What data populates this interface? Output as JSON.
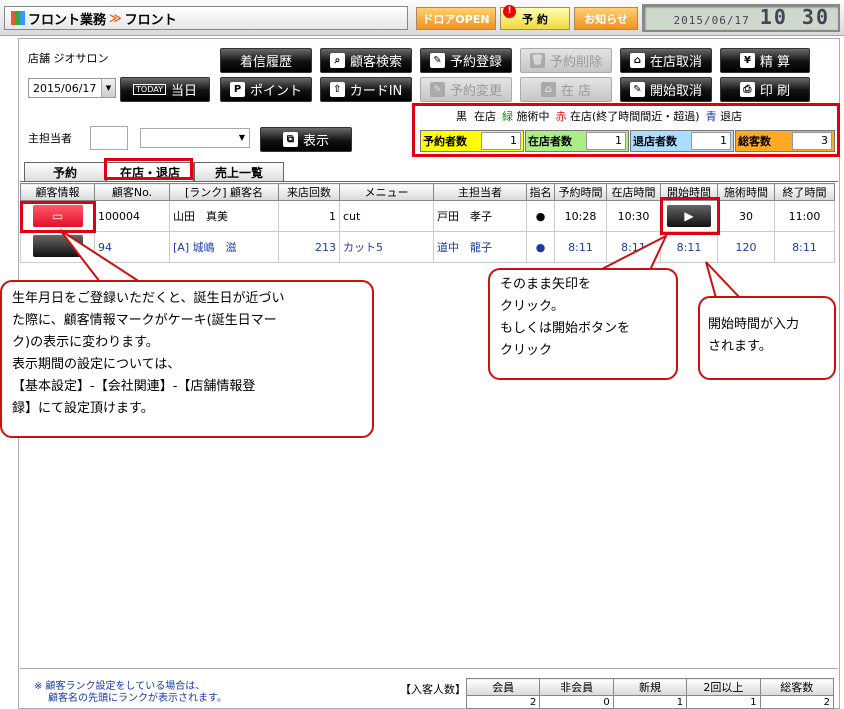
{
  "header": {
    "app_title": "フロント業務",
    "separator": "≫",
    "screen_title": "フロント",
    "buttons": [
      {
        "label": "ドロアOPEN"
      },
      {
        "label": "予 約"
      },
      {
        "label": "お知らせ"
      }
    ],
    "badge": "!",
    "date": "2015/06/17",
    "time": "10 30"
  },
  "store": {
    "label": "店舗",
    "name": "ジオサロン",
    "date": "2015/06/17",
    "today_small": "TODAY",
    "today": "当日"
  },
  "actions": [
    {
      "label": "着信履歴",
      "icon": "",
      "enabled": true
    },
    {
      "label": "顧客検索",
      "icon": "search-icon",
      "enabled": true
    },
    {
      "label": "予約登録",
      "icon": "edit-icon",
      "enabled": true
    },
    {
      "label": "予約削除",
      "icon": "trash-icon",
      "enabled": false
    },
    {
      "label": "在店取消",
      "icon": "home-icon",
      "enabled": true
    },
    {
      "label": "精 算",
      "icon": "yen-icon",
      "enabled": true
    },
    {
      "label": "ポイント",
      "icon": "p-icon",
      "enabled": true
    },
    {
      "label": "カードIN",
      "icon": "up-icon",
      "enabled": true
    },
    {
      "label": "予約変更",
      "icon": "edit-icon",
      "enabled": false
    },
    {
      "label": "在 店",
      "icon": "home-icon",
      "enabled": false
    },
    {
      "label": "開始取消",
      "icon": "edit-icon",
      "enabled": true
    },
    {
      "label": "印 刷",
      "icon": "print-icon",
      "enabled": true
    }
  ],
  "legend": [
    {
      "key": "黒",
      "text": "在店",
      "color": "#000000"
    },
    {
      "key": "緑",
      "text": "施術中",
      "color": "#1a8a1a"
    },
    {
      "key": "赤",
      "text": "在店(終了時間間近・超過)",
      "color": "#dd1111"
    },
    {
      "key": "青",
      "text": "退店",
      "color": "#1a3ba6"
    }
  ],
  "counts": [
    {
      "label": "予約者数",
      "value": "1",
      "color": "#ffff00"
    },
    {
      "label": "在店者数",
      "value": "1",
      "color": "#aaee88"
    },
    {
      "label": "退店者数",
      "value": "1",
      "color": "#aaddff"
    },
    {
      "label": "総客数",
      "value": "3",
      "color": "#ffaa22"
    }
  ],
  "staff": {
    "label": "主担当者",
    "show_button": "表示"
  },
  "tabs": [
    {
      "label": "予約"
    },
    {
      "label": "在店・退店"
    },
    {
      "label": "売上一覧"
    }
  ],
  "table": {
    "headers": [
      "顧客情報",
      "顧客No.",
      "[ランク] 顧客名",
      "来店回数",
      "メニュー",
      "主担当者",
      "指名",
      "予約時間",
      "在店時間",
      "開始時間",
      "施術時間",
      "終了時間"
    ],
    "rows": [
      {
        "no": "100004",
        "name": "山田　真美",
        "visits": "1",
        "menu": "cut",
        "staff": "戸田　孝子",
        "shimei": "●",
        "reserve": "10:28",
        "arrive": "10:30",
        "start": "",
        "duration": "30",
        "end": "11:00",
        "color": "#000000"
      },
      {
        "no": "94",
        "name": "[A] 城嶋　滋",
        "visits": "213",
        "menu": "カット5",
        "staff": "道中　龍子",
        "shimei": "●",
        "reserve": "8:11",
        "arrive": "8:11",
        "start": "8:11",
        "duration": "120",
        "end": "8:11",
        "color": "#1a3ba6"
      }
    ]
  },
  "callouts": {
    "birthday": [
      "生年月日をご登録いただくと、誕生日が近づい",
      "た際に、顧客情報マークがケーキ(誕生日マー",
      "ク)の表示に変わります。",
      "表示期間の設定については、",
      "【基本設定】-【会社関連】-【店舗情報登",
      "録】にて設定頂けます。"
    ],
    "arrow": [
      "そのまま矢印を",
      "クリック。",
      "もしくは開始ボタンを",
      "クリック"
    ],
    "start": [
      "開始時間が入力",
      "されます。"
    ]
  },
  "footer": {
    "note1": "※ 顧客ランク設定をしている場合は、",
    "note2": "顧客名の先頭にランクが表示されます。",
    "summary_label": "【入客人数】",
    "summary_headers": [
      "会員",
      "非会員",
      "新規",
      "2回以上",
      "総客数"
    ],
    "summary_values": [
      "2",
      "0",
      "1",
      "1",
      "2"
    ]
  }
}
